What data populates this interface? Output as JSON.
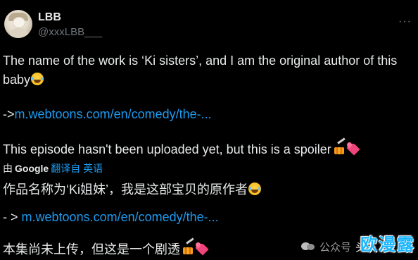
{
  "tweet": {
    "display_name": "LBB",
    "handle": "@xxxLBB___",
    "more_icon": "···",
    "line1": "The name of the work is ‘Ki sisters’, and I am the original author of this",
    "line2": "baby",
    "link1_prefix": "->",
    "link1": "m.webtoons.com/en/comedy/the-...",
    "line3": "This episode hasn't been uploaded yet, but this is a spoiler",
    "translated_by": "由",
    "google_label": "Google",
    "translate_from": "翻译自 英语",
    "zh_line1": "作品名称为‘Ki姐妹’，我是这部宝贝的原作者",
    "link2_prefix": "- >",
    "link2": "m.webtoons.com/en/comedy/the-...",
    "zh_line2": "本集尚未上传，但这是一个剧透"
  },
  "watermark": {
    "account": "公众号",
    "tail": "头条",
    "brand": "欧漫露"
  },
  "icons": {
    "avatar": "avatar",
    "more": "more-horizontal-icon",
    "laugh": "laughing-tears-emoji",
    "fire": "fire-emoji",
    "hearts": "two-hearts-emoji",
    "wechat": "wechat-icon"
  },
  "colors": {
    "background": "#000000",
    "text": "#e7e9ea",
    "secondary": "#71767b",
    "link": "#1d9bf0"
  }
}
